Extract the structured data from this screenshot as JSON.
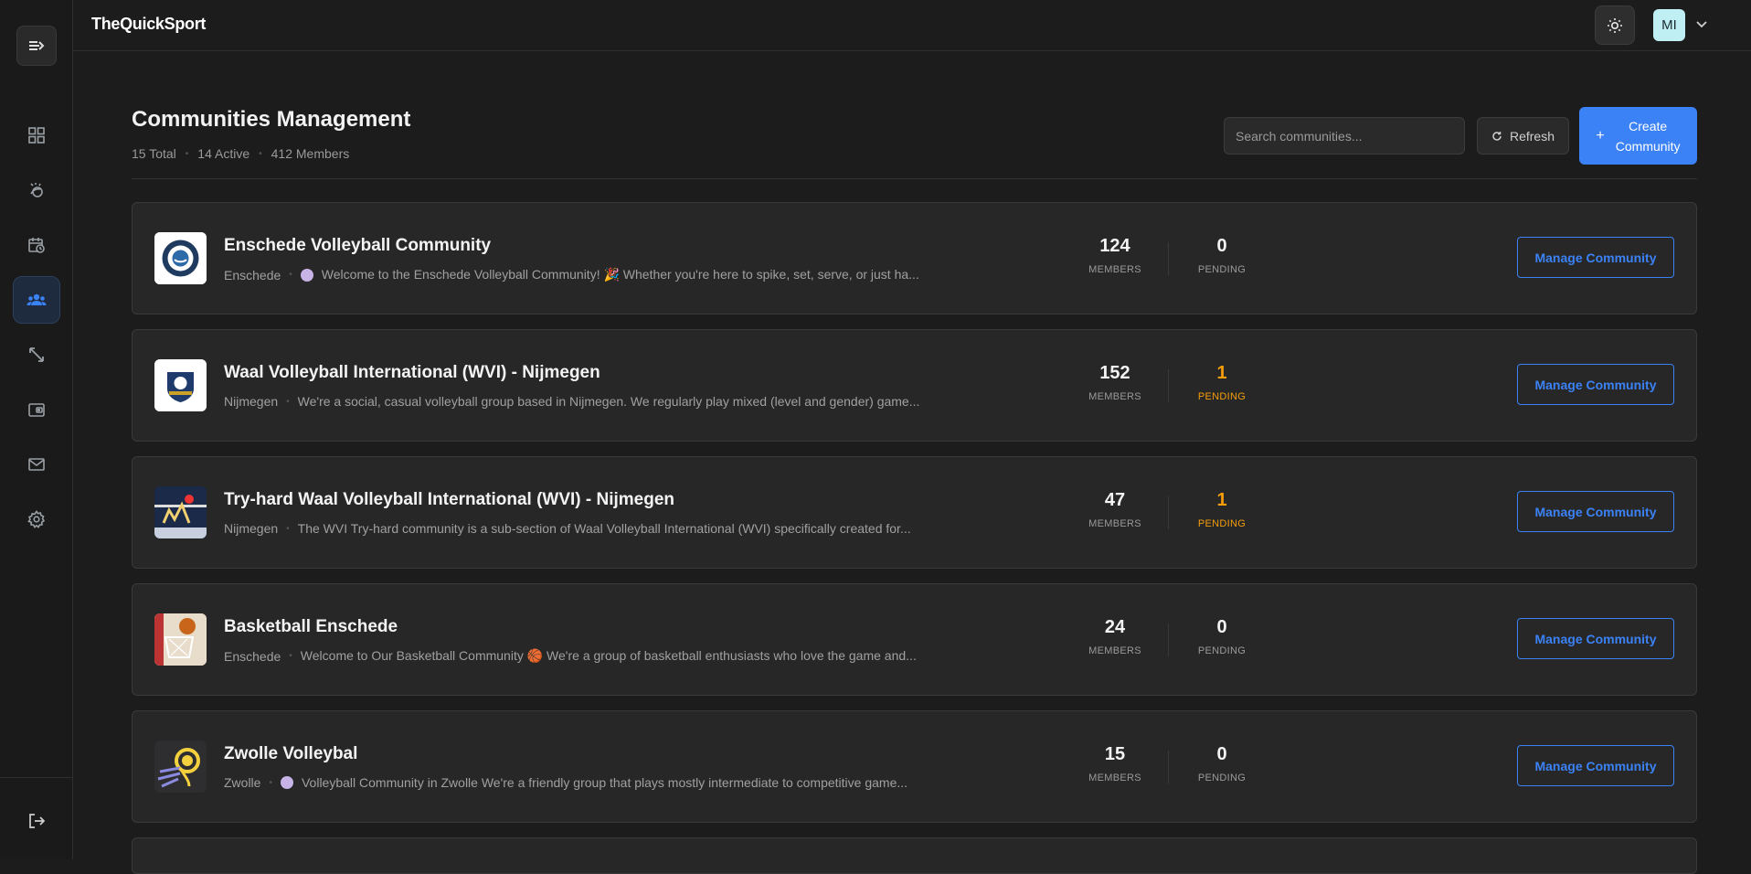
{
  "app": {
    "logo": "TheQuickSport",
    "avatar_initials": "MI"
  },
  "sidebar": {
    "items": [
      {
        "name": "dashboard-icon"
      },
      {
        "name": "sports-icon"
      },
      {
        "name": "calendar-icon"
      },
      {
        "name": "communities-icon",
        "active": true
      },
      {
        "name": "expand-icon"
      },
      {
        "name": "wallet-icon"
      },
      {
        "name": "mail-icon"
      },
      {
        "name": "settings-icon"
      }
    ],
    "logout_icon": "logout-icon"
  },
  "header": {
    "title": "Communities Management",
    "total": "15 Total",
    "active": "14 Active",
    "members": "412 Members",
    "search_placeholder": "Search communities...",
    "refresh_label": "Refresh",
    "create_label_1": "Create",
    "create_label_2": "Community"
  },
  "communities": [
    {
      "name": "Enschede Volleyball Community",
      "city": "Enschede",
      "emoji": "🟣",
      "description": "Welcome to the Enschede Volleyball Community! 🎉 Whether you're here to spike, set, serve, or just ha...",
      "members": "124",
      "pending": "0",
      "members_label": "MEMBERS",
      "pending_label": "PENDING",
      "action": "Manage Community"
    },
    {
      "name": "Waal Volleyball International (WVI) - Nijmegen",
      "city": "Nijmegen",
      "emoji": "",
      "description": "We're a social, casual volleyball group based in Nijmegen. We regularly play mixed (level and gender) game...",
      "members": "152",
      "pending": "1",
      "members_label": "MEMBERS",
      "pending_label": "PENDING",
      "action": "Manage Community"
    },
    {
      "name": "Try-hard Waal Volleyball International (WVI) - Nijmegen",
      "city": "Nijmegen",
      "emoji": "",
      "description": "The WVI Try-hard community is a sub-section of Waal Volleyball International (WVI) specifically created for...",
      "members": "47",
      "pending": "1",
      "members_label": "MEMBERS",
      "pending_label": "PENDING",
      "action": "Manage Community"
    },
    {
      "name": "Basketball Enschede",
      "city": "Enschede",
      "emoji": "",
      "description": "Welcome to Our Basketball Community 🏀 We're a group of basketball enthusiasts who love the game and...",
      "members": "24",
      "pending": "0",
      "members_label": "MEMBERS",
      "pending_label": "PENDING",
      "action": "Manage Community"
    },
    {
      "name": "Zwolle Volleybal",
      "city": "Zwolle",
      "emoji": "🟣",
      "description": "Volleyball Community in Zwolle We're a friendly group that plays mostly intermediate to competitive game...",
      "members": "15",
      "pending": "0",
      "members_label": "MEMBERS",
      "pending_label": "PENDING",
      "action": "Manage Community"
    }
  ],
  "colors": {
    "accent": "#3b82f6",
    "warning": "#f59e0b"
  }
}
